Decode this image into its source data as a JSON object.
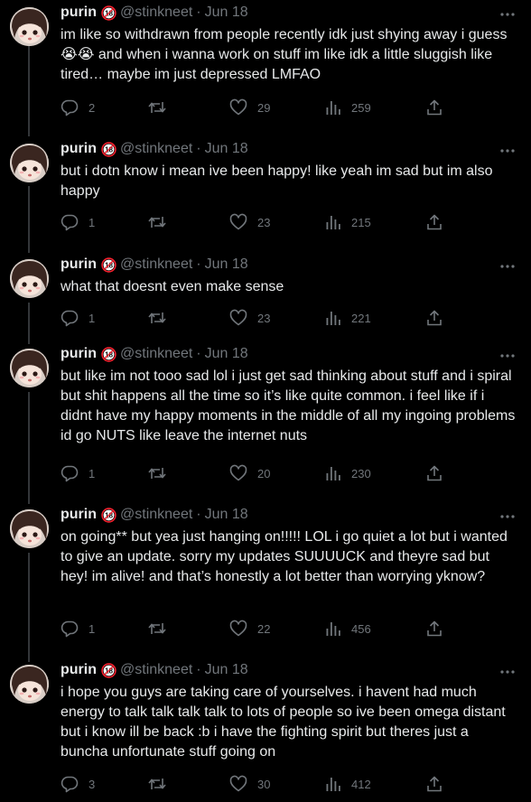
{
  "tweets": [
    {
      "name": "purin",
      "handle": "@stinkneet",
      "separator": "·",
      "date": "Jun 18",
      "text": "im like so withdrawn from people recently idk just shying away i guess 😭😭 and when i wanna work on stuff im like idk a little sluggish like tired… maybe im just depressed LMFAO",
      "replies": "2",
      "reposts": "",
      "likes": "29",
      "views": "259"
    },
    {
      "name": "purin",
      "handle": "@stinkneet",
      "separator": "·",
      "date": "Jun 18",
      "text": "but i dotn know i mean ive been happy! like yeah im sad but im also happy",
      "replies": "1",
      "reposts": "",
      "likes": "23",
      "views": "215"
    },
    {
      "name": "purin",
      "handle": "@stinkneet",
      "separator": "·",
      "date": "Jun 18",
      "text": "what that doesnt even make sense",
      "replies": "1",
      "reposts": "",
      "likes": "23",
      "views": "221"
    },
    {
      "name": "purin",
      "handle": "@stinkneet",
      "separator": "·",
      "date": "Jun 18",
      "text": "but like im not tooo sad lol i just get sad thinking about stuff and i spiral but shit happens all the time so it’s like quite common. i feel like if i didnt have my happy moments in the middle of all my ingoing problems id go NUTS like leave the internet nuts",
      "replies": "1",
      "reposts": "",
      "likes": "20",
      "views": "230"
    },
    {
      "name": "purin",
      "handle": "@stinkneet",
      "separator": "·",
      "date": "Jun 18",
      "text": "on going** but yea just hanging on!!!!! LOL i go quiet a lot but i wanted to give an update. sorry my updates SUUUUCK and theyre sad but hey! im alive! and that’s honestly a lot better than worrying yknow?",
      "replies": "1",
      "reposts": "",
      "likes": "22",
      "views": "456"
    },
    {
      "name": "purin",
      "handle": "@stinkneet",
      "separator": "·",
      "date": "Jun 18",
      "text": "i hope you guys are taking care of yourselves. i havent had much energy to talk talk talk talk to lots of people so ive been omega distant but i know ill be back :b i have the fighting spirit but theres just a buncha unfortunate stuff going on",
      "replies": "3",
      "reposts": "",
      "likes": "30",
      "views": "412"
    }
  ],
  "colors": {
    "background": "#000000",
    "text": "#e7e9ea",
    "secondary": "#71767b",
    "thread_line": "#333639",
    "badge_red": "#f4212e"
  },
  "icons": {
    "reply": "reply-icon",
    "repost": "repost-icon",
    "like": "heart-icon",
    "views": "views-icon",
    "share": "share-icon",
    "more": "more-icon",
    "badge": "eighteen-plus-icon"
  }
}
